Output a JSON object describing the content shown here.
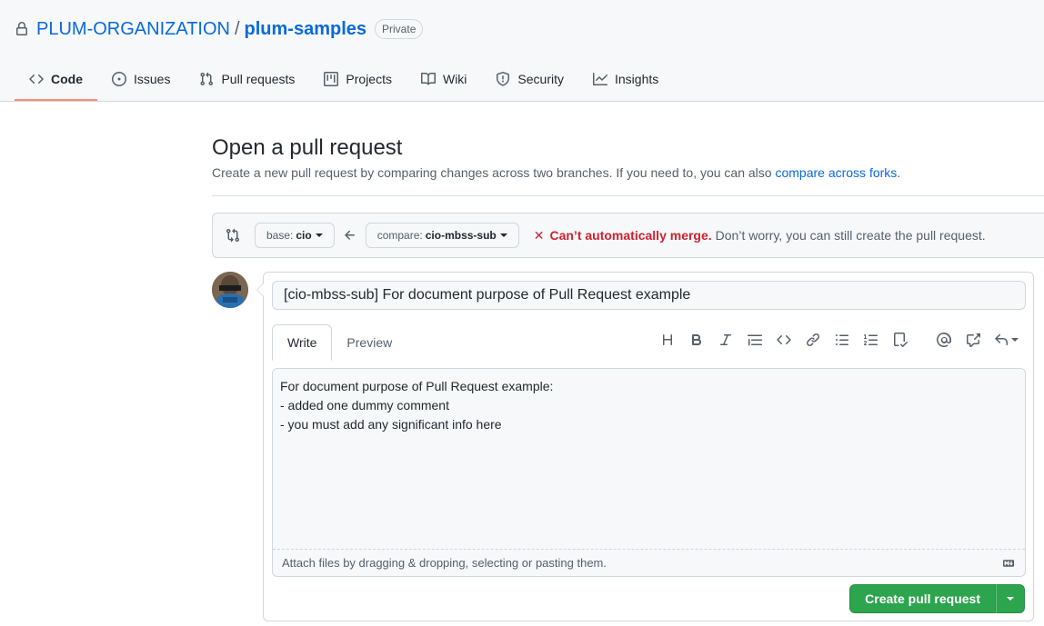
{
  "repo": {
    "owner": "PLUM-ORGANIZATION",
    "separator": "/",
    "name": "plum-samples",
    "visibility": "Private"
  },
  "nav": {
    "tabs": [
      {
        "label": "Code",
        "icon": "code-icon",
        "active": true
      },
      {
        "label": "Issues",
        "icon": "issue-opened-icon"
      },
      {
        "label": "Pull requests",
        "icon": "git-pull-request-icon"
      },
      {
        "label": "Projects",
        "icon": "project-icon"
      },
      {
        "label": "Wiki",
        "icon": "book-icon"
      },
      {
        "label": "Security",
        "icon": "shield-icon"
      },
      {
        "label": "Insights",
        "icon": "graph-icon"
      }
    ]
  },
  "page": {
    "title": "Open a pull request",
    "subtitle": "Create a new pull request by comparing changes across two branches. If you need to, you can also",
    "subtitle_link": "compare across forks",
    "subtitle_end": "."
  },
  "range": {
    "base_prefix": "base:",
    "base_branch": "cio",
    "compare_prefix": "compare:",
    "compare_branch": "cio-mbss-sub",
    "merge_status": "Can’t automatically merge.",
    "merge_note": "Don’t worry, you can still create the pull request."
  },
  "form": {
    "title_value": "[cio-mbss-sub] For document purpose of Pull Request example",
    "write_tab": "Write",
    "preview_tab": "Preview",
    "body_value": "For document purpose of Pull Request example:\n- added one dummy comment\n- you must add any significant info here",
    "attach_hint": "Attach files by dragging & dropping, selecting or pasting them.",
    "submit_label": "Create pull request"
  },
  "colors": {
    "accent": "#0969da",
    "danger": "#cf222e",
    "primary_button": "#2da44e",
    "active_tab_underline": "#fd8c73"
  }
}
